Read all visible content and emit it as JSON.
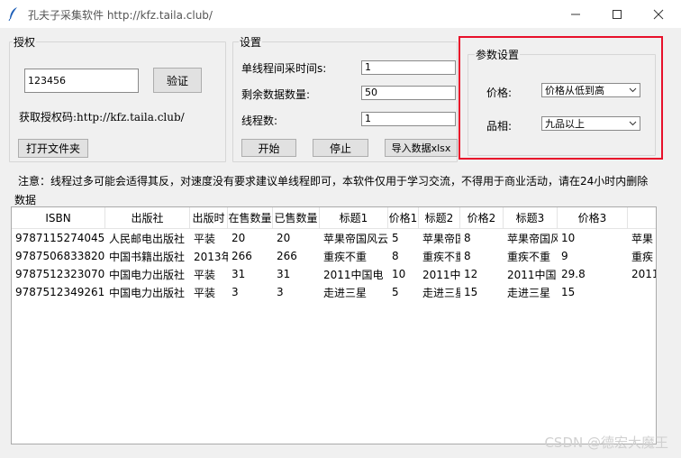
{
  "window": {
    "title": "孔夫子采集软件 http://kfz.taila.club/",
    "minimize_icon": "minimize-icon",
    "maximize_icon": "maximize-icon",
    "close_icon": "close-icon"
  },
  "auth": {
    "group_title": "授权",
    "code_value": "123456",
    "verify_label": "验证",
    "get_code_text": "获取授权码:http://kfz.taila.club/",
    "open_folder_label": "打开文件夹"
  },
  "settings": {
    "group_title": "设置",
    "interval_label": "单线程间采时间s:",
    "interval_value": "1",
    "remaining_label": "剩余数据数量:",
    "remaining_value": "50",
    "threads_label": "线程数:",
    "threads_value": "1",
    "start_label": "开始",
    "stop_label": "停止",
    "import_label": "导入数据xlsx"
  },
  "params": {
    "group_title": "参数设置",
    "price_label": "价格:",
    "price_value": "价格从低到高",
    "quality_label": "品相:",
    "quality_value": "九品以上"
  },
  "notice": "注意：线程过多可能会适得其反，对速度没有要求建议单线程即可，本软件仅用于学习交流，不得用于商业活动，请在24小时内删除",
  "data_section_label": "数据",
  "table": {
    "columns": [
      "ISBN",
      "出版社",
      "出版时",
      "在售数量",
      "已售数量",
      "标题1",
      "价格1",
      "标题2",
      "价格2",
      "标题3",
      "价格3",
      ""
    ],
    "rows": [
      [
        "9787115274045",
        "人民邮电出版社",
        "平装",
        "20",
        "20",
        "苹果帝国风云",
        "5",
        "苹果帝国",
        "8",
        "苹果帝国风",
        "10",
        "苹果"
      ],
      [
        "9787506833820",
        "中国书籍出版社",
        "2013年",
        "266",
        "266",
        "重疾不重",
        "8",
        "重疾不重",
        "8",
        "重疾不重",
        "9",
        "重疾"
      ],
      [
        "9787512323070",
        "中国电力出版社",
        "平装",
        "31",
        "31",
        "2011中国电",
        "10",
        "2011中",
        "12",
        "2011中国",
        "29.8",
        "2011"
      ],
      [
        "9787512349261",
        "中国电力出版社",
        "平装",
        "3",
        "3",
        "走进三星",
        "5",
        "走进三星",
        "15",
        "走进三星",
        "15",
        ""
      ]
    ]
  },
  "watermark": "CSDN @德宏大魔王",
  "colors": {
    "highlight_rect": "#e8102a"
  }
}
